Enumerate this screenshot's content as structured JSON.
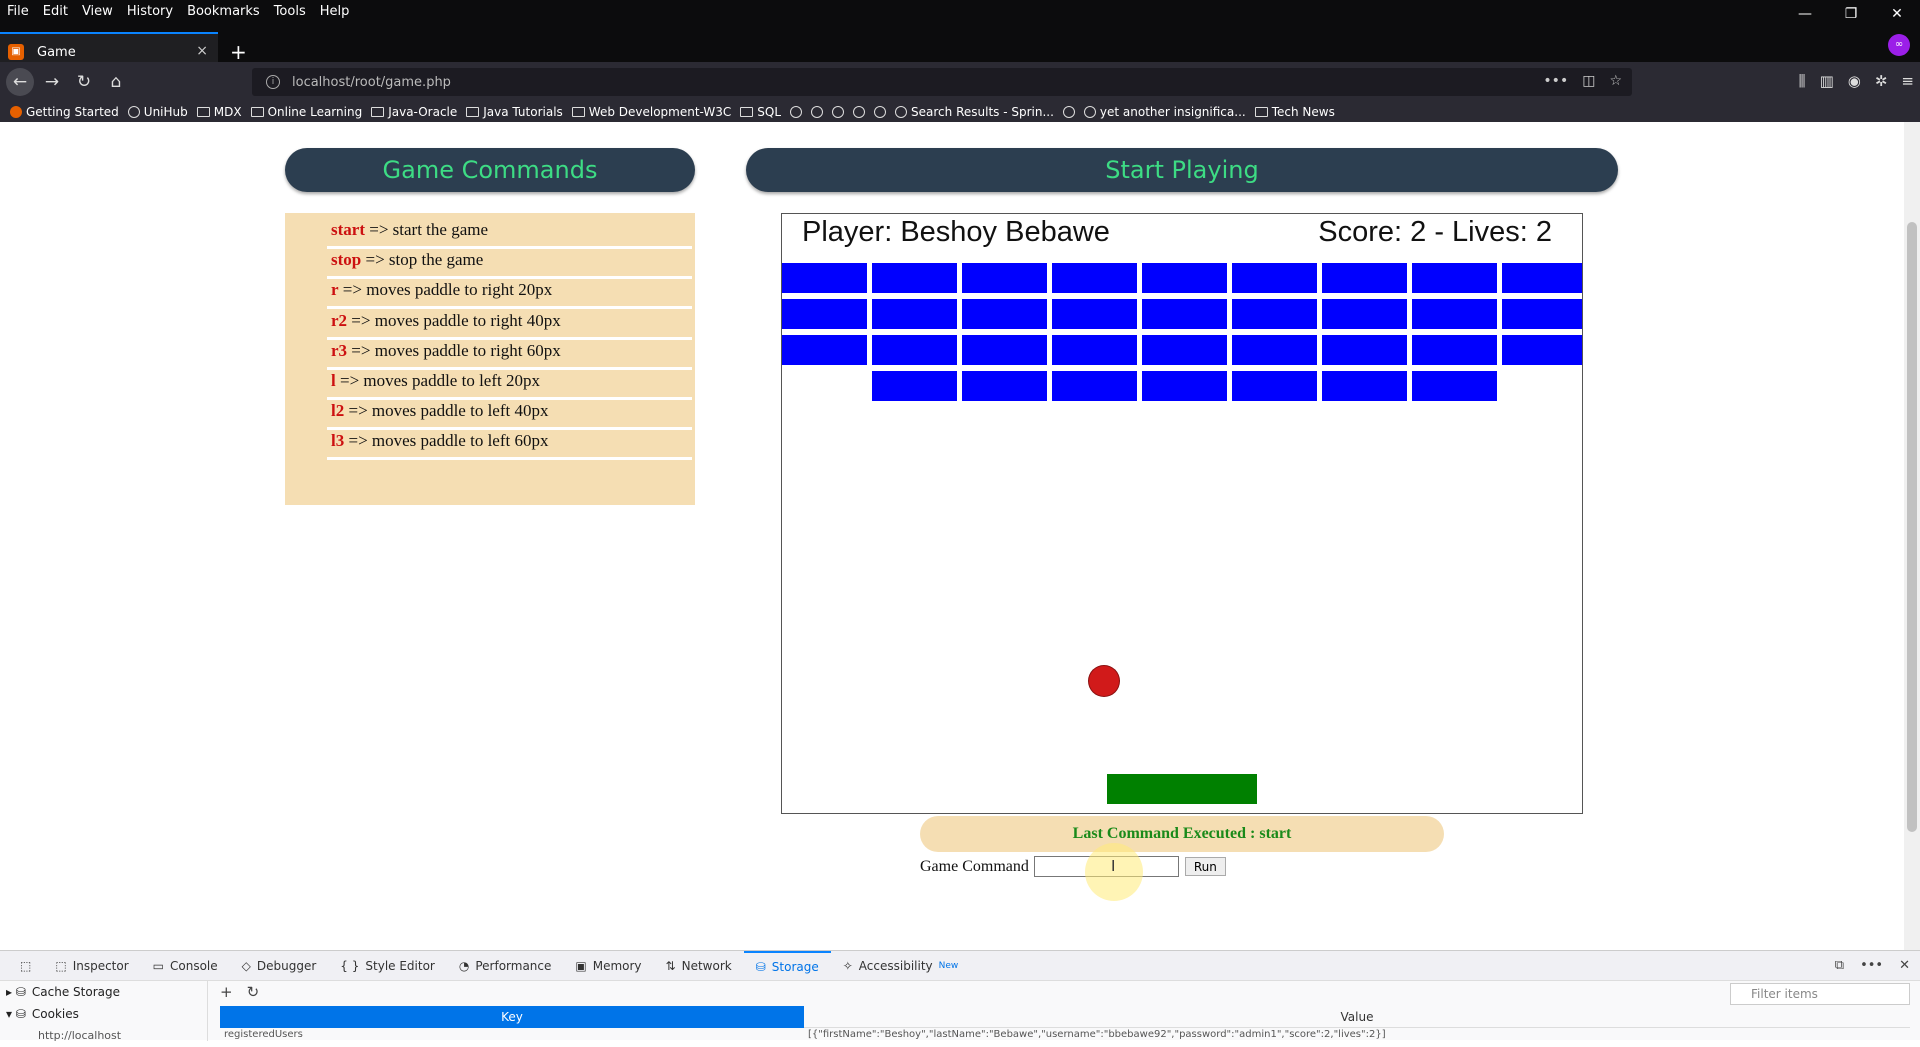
{
  "browser": {
    "menu": [
      "File",
      "Edit",
      "View",
      "History",
      "Bookmarks",
      "Tools",
      "Help"
    ],
    "window_controls": [
      "—",
      "❐",
      "✕"
    ],
    "tab": {
      "title": "Game",
      "close": "×"
    },
    "new_tab": "+",
    "url": "localhost/root/game.php",
    "bookmarks": [
      {
        "label": "Getting Started",
        "icon": "firefox-icon"
      },
      {
        "label": "UniHub",
        "icon": "globe-icon"
      },
      {
        "label": "MDX",
        "icon": "folder-icon"
      },
      {
        "label": "Online Learning",
        "icon": "folder-icon"
      },
      {
        "label": "Java-Oracle",
        "icon": "folder-icon"
      },
      {
        "label": "Java Tutorials",
        "icon": "folder-icon"
      },
      {
        "label": "Web Development-W3C",
        "icon": "folder-icon"
      },
      {
        "label": "SQL",
        "icon": "folder-icon"
      },
      {
        "label": "",
        "icon": "globe-icon"
      },
      {
        "label": "",
        "icon": "globe-icon"
      },
      {
        "label": "",
        "icon": "globe-icon"
      },
      {
        "label": "",
        "icon": "globe-icon"
      },
      {
        "label": "",
        "icon": "globe-icon"
      },
      {
        "label": "Search Results - Sprin...",
        "icon": "globe-icon"
      },
      {
        "label": "",
        "icon": "globe-icon"
      },
      {
        "label": "yet another insignifica...",
        "icon": "globe-icon"
      },
      {
        "label": "Tech News",
        "icon": "folder-icon"
      }
    ]
  },
  "page": {
    "commands_header": "Game Commands",
    "play_header": "Start Playing",
    "commands": [
      {
        "key": "start",
        "desc": " => start the game"
      },
      {
        "key": "stop",
        "desc": " => stop the game"
      },
      {
        "key": "r",
        "desc": " => moves paddle to right 20px"
      },
      {
        "key": "r2",
        "desc": " => moves paddle to right 40px"
      },
      {
        "key": "r3",
        "desc": " => moves paddle to right 60px"
      },
      {
        "key": "l",
        "desc": " => moves paddle to left 20px"
      },
      {
        "key": "l2",
        "desc": " => moves paddle to left 40px"
      },
      {
        "key": "l3",
        "desc": " => moves paddle to left 60px"
      }
    ],
    "game": {
      "player_text": "Player: Beshoy Bebawe",
      "score_text": "Score: 2 - Lives: 2",
      "brick_rows": [
        [
          1,
          1,
          1,
          1,
          1,
          1,
          1,
          1,
          1
        ],
        [
          1,
          1,
          1,
          1,
          1,
          1,
          1,
          1,
          1
        ],
        [
          1,
          1,
          1,
          1,
          1,
          1,
          1,
          1,
          1
        ],
        [
          0,
          1,
          1,
          1,
          1,
          1,
          1,
          1,
          0
        ]
      ],
      "colors": {
        "brick": "#0000ff",
        "ball": "#d11a1a",
        "paddle": "#008000"
      }
    },
    "last_command": "Last Command Executed : start",
    "command_label": "Game Command",
    "command_value": "",
    "run_button": "Run"
  },
  "devtools": {
    "tabs": [
      "Inspector",
      "Console",
      "Debugger",
      "Style Editor",
      "Performance",
      "Memory",
      "Network",
      "Storage",
      "Accessibility"
    ],
    "active_tab": "Storage",
    "new_badge": "New",
    "sidebar": [
      "Cache Storage",
      "Cookies"
    ],
    "sidebar_sub": "http://localhost",
    "filter_placeholder": "Filter items",
    "col_key": "Key",
    "col_value": "Value",
    "row_key": "registeredUsers",
    "row_value": "[{\"firstName\":\"Beshoy\",\"lastName\":\"Bebawe\",\"username\":\"bbebawe92\",\"password\":\"admin1\",\"score\":2,\"lives\":2}]"
  }
}
